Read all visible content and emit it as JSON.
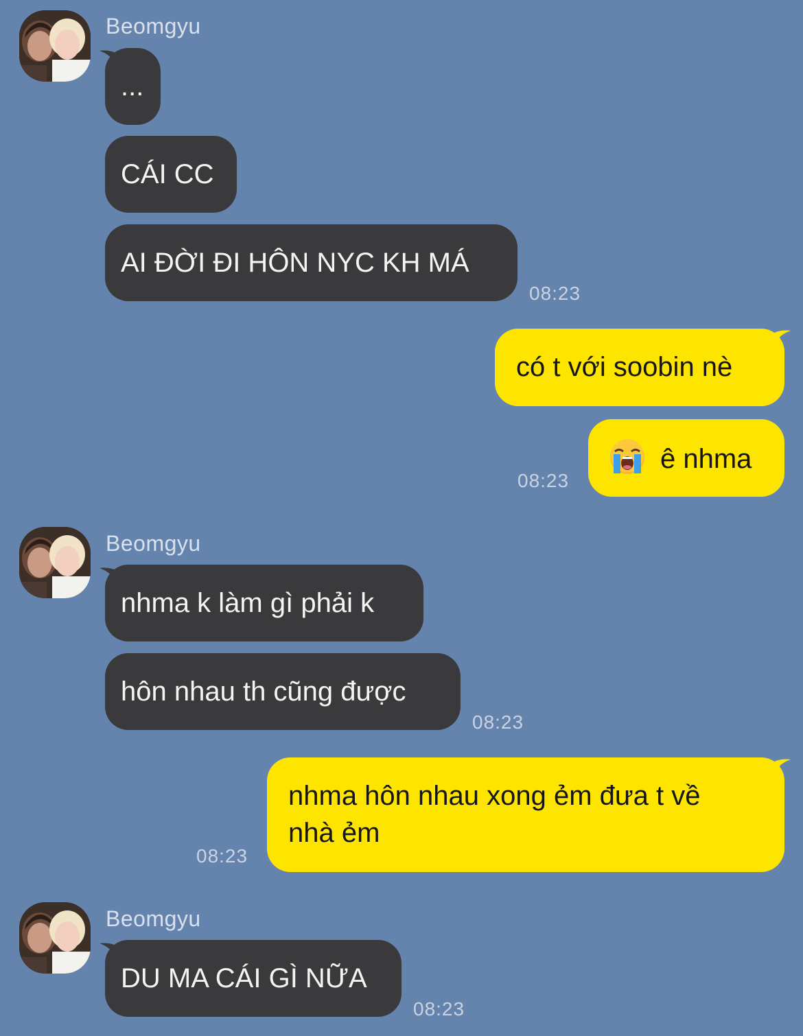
{
  "chat": {
    "contact_name": "Beomgyu",
    "messages": [
      {
        "id": "m1",
        "text": "..."
      },
      {
        "id": "m2",
        "text": "CÁI CC"
      },
      {
        "id": "m3",
        "text": "AI ĐỜI ĐI HÔN NYC KH MÁ",
        "time": "08:23"
      },
      {
        "id": "m4",
        "text": "có t với soobin nè"
      },
      {
        "id": "m5",
        "emoji": "loudly-crying-face",
        "text": "ê nhma",
        "time": "08:23"
      },
      {
        "id": "m6",
        "text": "nhma k làm gì phải k"
      },
      {
        "id": "m7",
        "text": "hôn nhau th cũng được",
        "time": "08:23"
      },
      {
        "id": "m8",
        "line1": "nhma hôn nhau xong ẻm đưa t về",
        "line2": "nhà ẻm",
        "time": "08:23"
      },
      {
        "id": "m9",
        "text": "DU MA CÁI GÌ NỮA",
        "time": "08:23"
      }
    ]
  },
  "colors": {
    "background": "#6584ad",
    "received_bubble": "#3a3a3c",
    "sent_bubble": "#fee500"
  }
}
